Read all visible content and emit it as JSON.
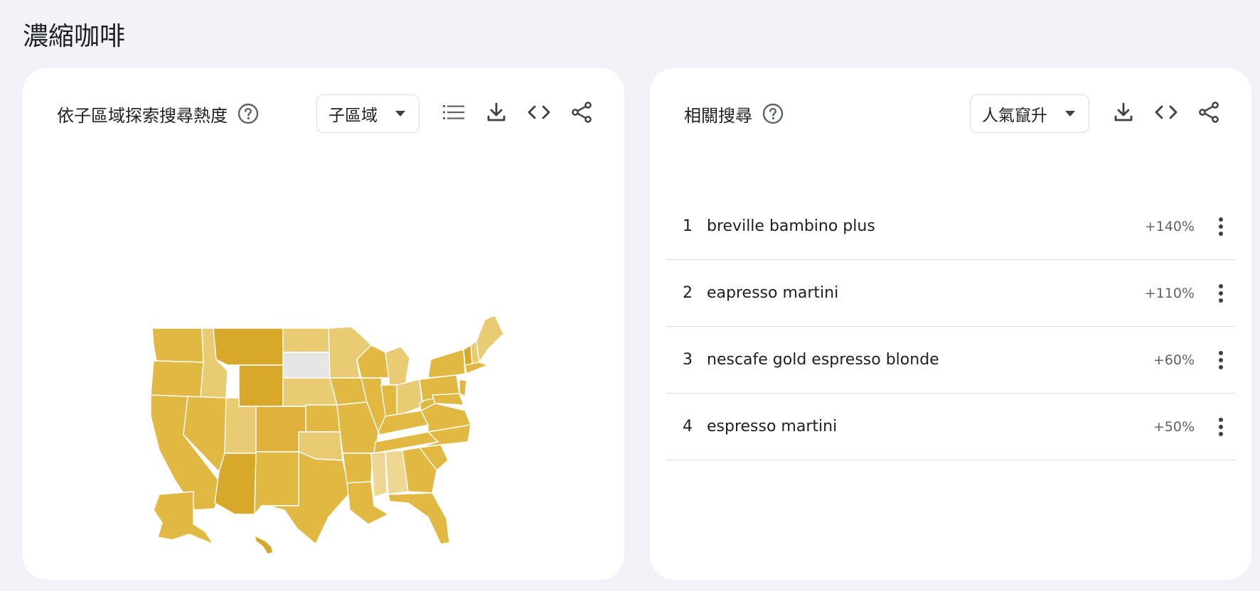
{
  "page": {
    "title": "濃縮咖啡"
  },
  "left_card": {
    "title": "依子區域探索搜尋熱度",
    "select_value": "子區域",
    "icons": [
      "help-icon",
      "list-icon",
      "download-icon",
      "embed-icon",
      "share-icon"
    ]
  },
  "right_card": {
    "title": "相關搜尋",
    "select_value": "人氣竄升",
    "icons": [
      "help-icon",
      "download-icon",
      "embed-icon",
      "share-icon",
      "more-vert-icon"
    ],
    "rows": [
      {
        "rank": "1",
        "query": "breville bambino plus",
        "value": "+140%"
      },
      {
        "rank": "2",
        "query": "eapresso martini",
        "value": "+110%"
      },
      {
        "rank": "3",
        "query": "nescafe gold espresso blonde",
        "value": "+60%"
      },
      {
        "rank": "4",
        "query": "espresso martini",
        "value": "+50%"
      }
    ]
  },
  "colors": {
    "background": "#f1f3f8",
    "card": "#ffffff",
    "map_dark": "#d8a82a",
    "map_mid": "#e0b842",
    "map_light": "#e9cb74",
    "map_lighter": "#eed793",
    "map_nodata": "#e6e6e6",
    "icon": "#5f6368"
  }
}
